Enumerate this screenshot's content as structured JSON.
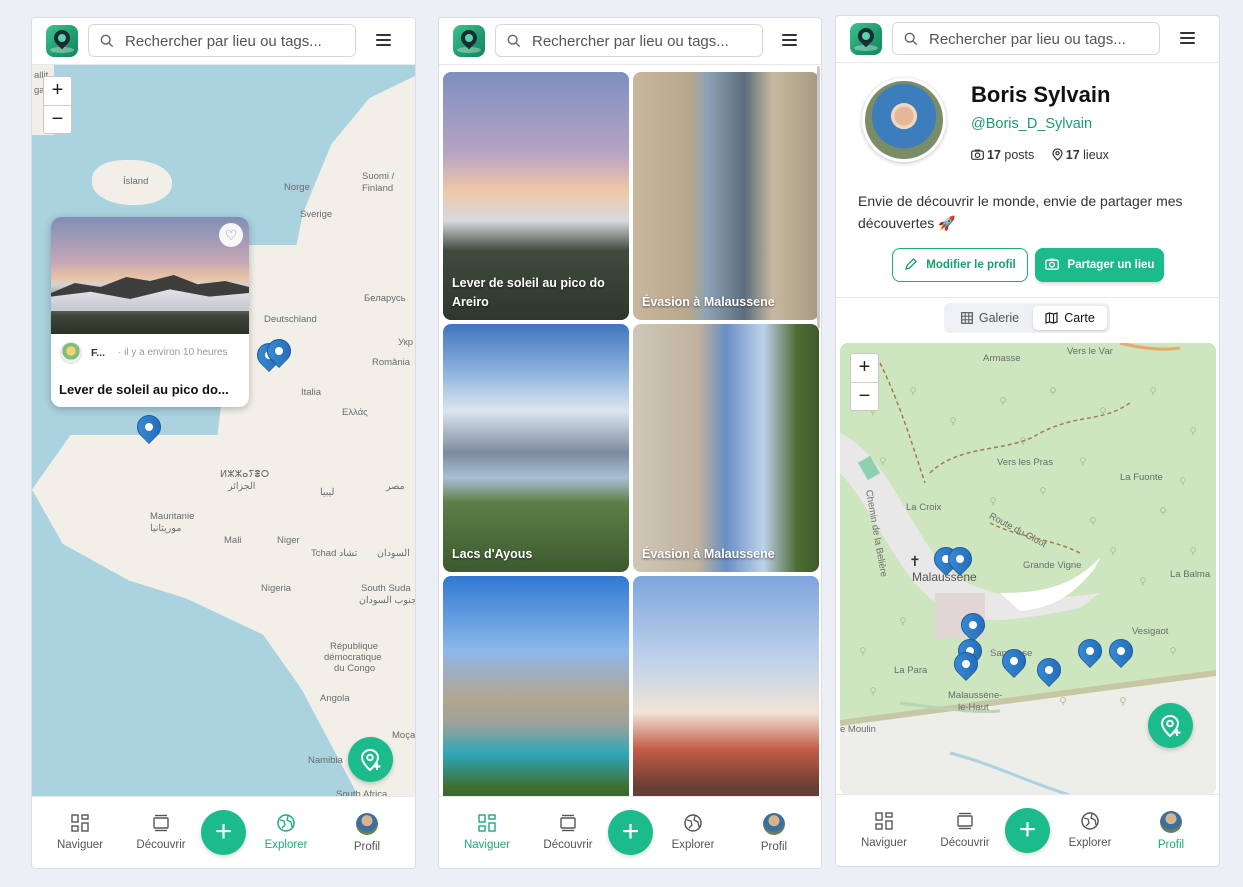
{
  "search_placeholder": "Rechercher par lieu ou tags...",
  "nav": {
    "naviguer": "Naviguer",
    "decouvrir": "Découvrir",
    "add": "+",
    "explorer": "Explorer",
    "profil": "Profil"
  },
  "colors": {
    "accent": "#1cbb8b",
    "accent_text": "#1a9c72",
    "pin": "#2a78c6",
    "map_water": "#aad3df",
    "map_land": "#f2efe9"
  },
  "screen1": {
    "zoom_in": "+",
    "zoom_out": "−",
    "map_labels": {
      "island": "Ísland",
      "norge": "Norge",
      "suomi": "Suomi /",
      "finland": "Finland",
      "sverige": "Sverige",
      "deutschland": "Deutschland",
      "belarus": "Беларусь",
      "romania": "România",
      "ukr": "Укр",
      "italia": "Italia",
      "ellas": "Ελλάς",
      "algeria_tf": "ⵍⵣⵣⴰⵢⴻⵔ",
      "algeria_ar": "الجزائر",
      "libya": "ليبيا",
      "egypt": "مصر",
      "mauritanie": "Mauritanie",
      "mauritanie_ar": "موريتانيا",
      "mali": "Mali",
      "niger": "Niger",
      "tchad": "Tchad تشاد",
      "sudan": "السودان",
      "nigeria": "Nigeria",
      "south_sudan": "South Suda",
      "south_sudan_ar": "جنوب السودان",
      "rdc1": "République",
      "rdc2": "démocratique",
      "rdc3": "du Congo",
      "angola": "Angola",
      "namibia": "Namibia",
      "moca": "Moça",
      "south_africa": "South Africa",
      "iceland_frag": "allit",
      "frag2": "ga"
    },
    "popup": {
      "author": "F...",
      "time": "· il y a environ 10 heures",
      "title": "Lever de soleil au pico do..."
    }
  },
  "screen2": {
    "tiles": [
      {
        "label": "Lever de soleil au pico do Areiro"
      },
      {
        "label": "Évasion à Malaussene"
      },
      {
        "label": "Lacs d'Ayous"
      },
      {
        "label": "Évasion à Malaussene"
      },
      {
        "label": ""
      },
      {
        "label": ""
      }
    ]
  },
  "screen3": {
    "name": "Boris Sylvain",
    "handle": "@Boris_D_Sylvain",
    "posts_count": "17",
    "posts_label": "posts",
    "places_count": "17",
    "places_label": "lieux",
    "bio": "Envie de découvrir le monde, envie de partager mes découvertes 🚀",
    "edit_button": "Modifier le profil",
    "share_button": "Partager un lieu",
    "tab_gallery": "Galerie",
    "tab_map": "Carte",
    "zoom_in": "+",
    "zoom_out": "−",
    "map_labels": {
      "armasse": "Armasse",
      "vers_le_var": "Vers le Var",
      "vers_les_pras": "Vers les Pras",
      "la_fuonte": "La Fuonte",
      "la_croix": "La Croix",
      "route_cluot": "Route du Cluot",
      "chemin_beleire": "Chemin de la Belière",
      "malaussene": "Malaussène",
      "grande_vigne": "Grande Vigne",
      "la_balma": "La Balma",
      "vesigaot": "Vesigaot",
      "sant_jose": "Sant Jose",
      "la_para": "La Para",
      "malaussene_haut1": "Malaussène-",
      "malaussene_haut2": "le-Haut",
      "moulin": "e Moulin",
      "cluot_road": "Route du Cluot"
    }
  }
}
